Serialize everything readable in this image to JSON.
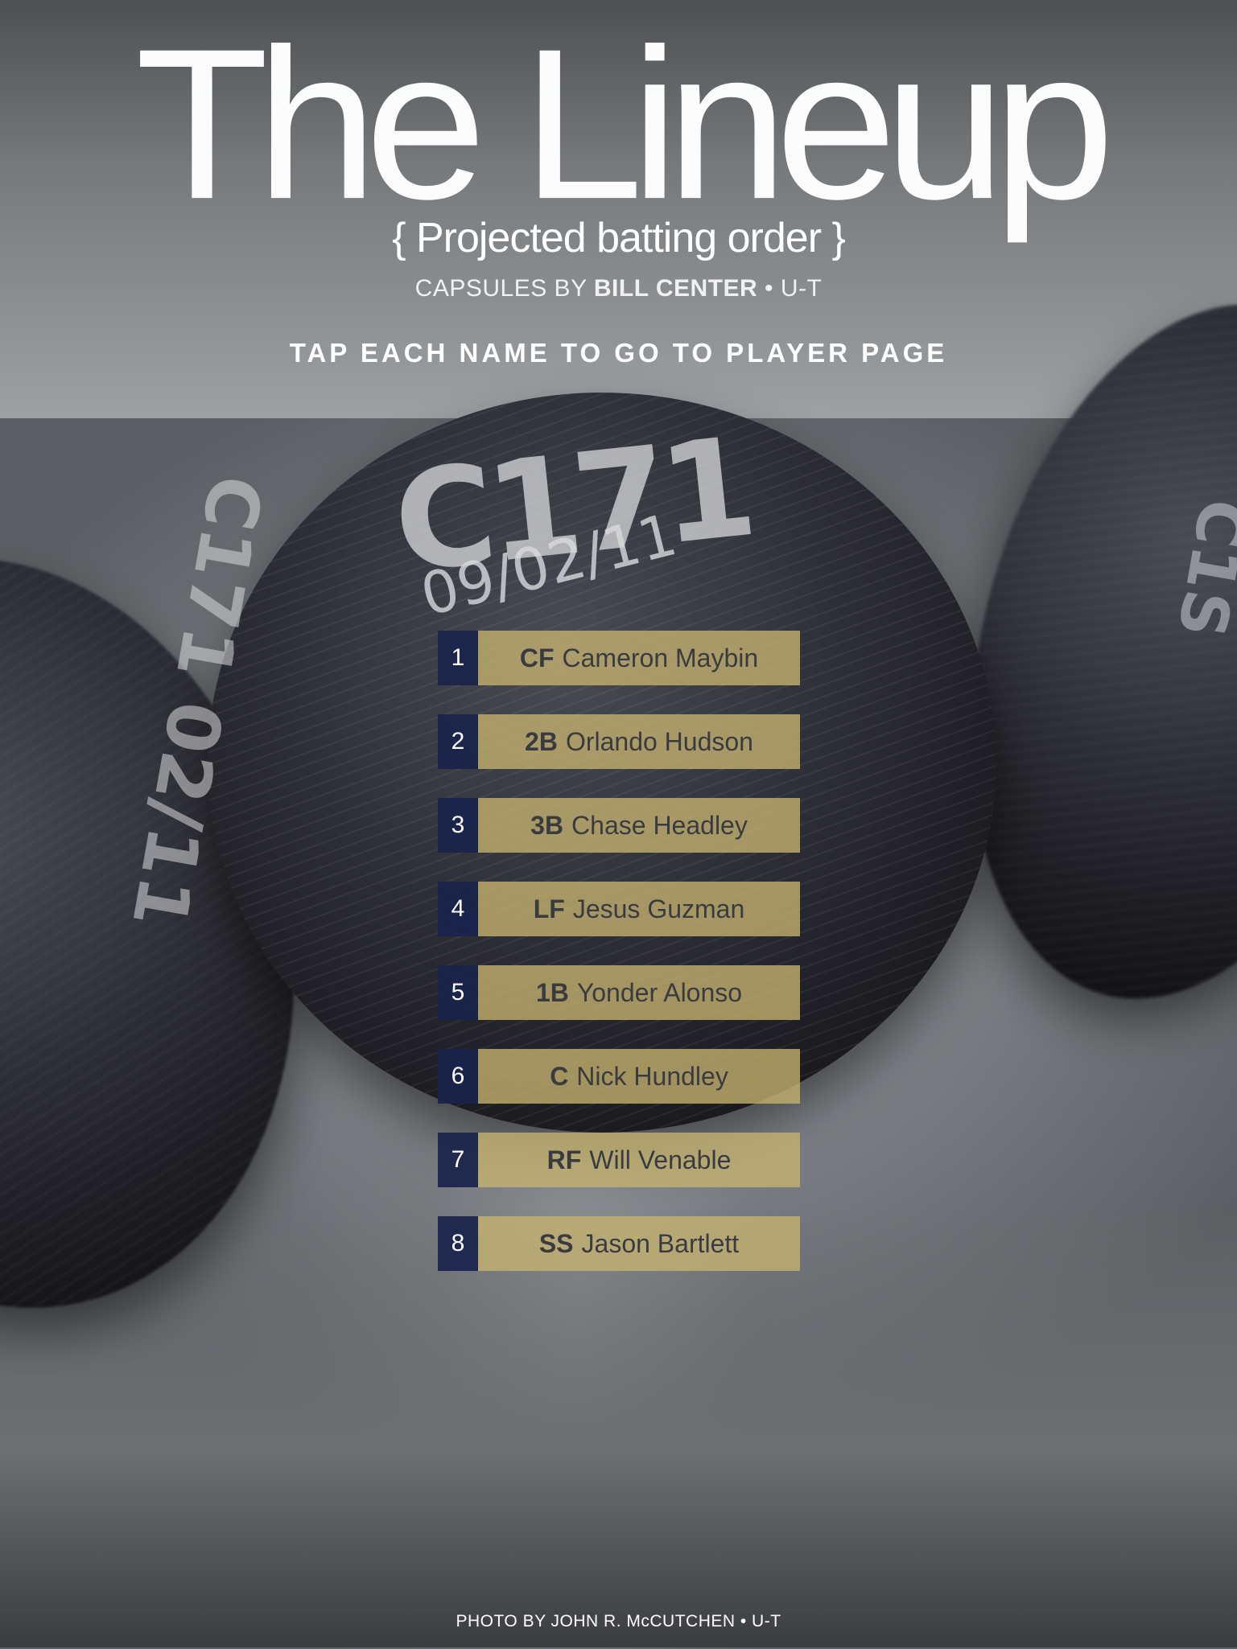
{
  "header": {
    "title": "The Lineup",
    "subtitle": "{ Projected batting order }",
    "credits_prefix": "CAPSULES BY ",
    "credits_author": "BILL CENTER",
    "credits_suffix": " • U-T",
    "instruction": "TAP EACH NAME TO GO TO PLAYER PAGE"
  },
  "background": {
    "engraving_center_logo": "C171",
    "engraving_center_date": "09/02/11",
    "engraving_left": "C171 02/11",
    "engraving_right": "C1S"
  },
  "lineup": [
    {
      "order": "1",
      "position": "CF",
      "player": "Cameron Maybin"
    },
    {
      "order": "2",
      "position": "2B",
      "player": "Orlando Hudson"
    },
    {
      "order": "3",
      "position": "3B",
      "player": "Chase Headley"
    },
    {
      "order": "4",
      "position": "LF",
      "player": "Jesus Guzman"
    },
    {
      "order": "5",
      "position": "1B",
      "player": "Yonder Alonso"
    },
    {
      "order": "6",
      "position": "C",
      "player": "Nick Hundley"
    },
    {
      "order": "7",
      "position": "RF",
      "player": "Will Venable"
    },
    {
      "order": "8",
      "position": "SS",
      "player": "Jason Bartlett"
    }
  ],
  "colors": {
    "number_bg": "#19234b",
    "name_bg": "#c6b470",
    "text_dark": "#3a3b40"
  },
  "footer": {
    "photo_credit": "PHOTO BY JOHN R. McCUTCHEN • U-T"
  }
}
